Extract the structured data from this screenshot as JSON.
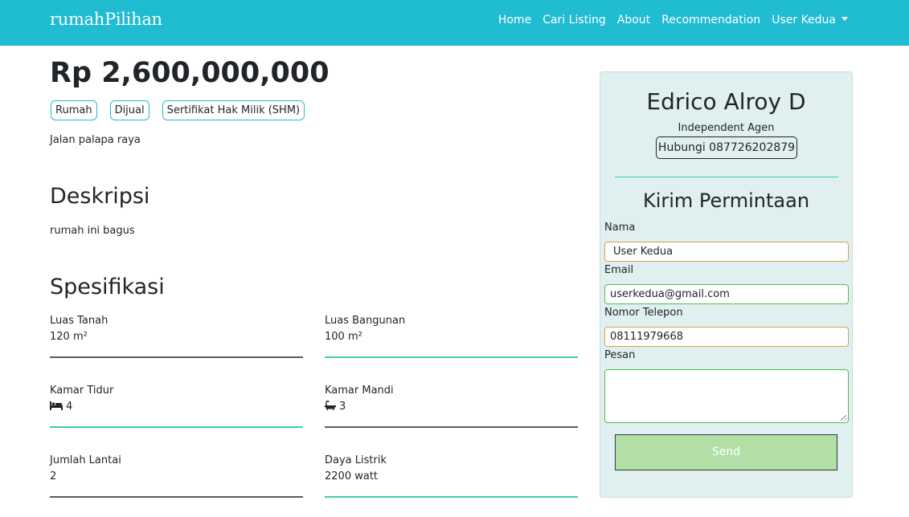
{
  "navbar": {
    "brand": "rumahPilihan",
    "links": [
      "Home",
      "Cari Listing",
      "About",
      "Recommendation"
    ],
    "user_menu": "User Kedua",
    "caret_icon": "chevron-down-icon"
  },
  "listing": {
    "price": "Rp 2,600,000,000",
    "badges": [
      "Rumah",
      "Dijual",
      "Sertifikat Hak Milik (SHM)"
    ],
    "address": "Jalan palapa raya"
  },
  "description": {
    "heading": "Deskripsi",
    "text": "rumah ini bagus"
  },
  "specs": {
    "heading": "Spesifikasi",
    "items": [
      {
        "label": "Luas Tanah",
        "value": "120 m²"
      },
      {
        "label": "Luas Bangunan",
        "value": "100 m²"
      },
      {
        "label": "Kamar Tidur",
        "value": "4",
        "icon": "bed-icon"
      },
      {
        "label": "Kamar Mandi",
        "value": "3",
        "icon": "bathtub-icon"
      },
      {
        "label": "Jumlah Lantai",
        "value": "2"
      },
      {
        "label": "Daya Listrik",
        "value": "2200 watt"
      }
    ]
  },
  "agent": {
    "name": "Edrico Alroy D",
    "role": "Independent Agen",
    "contact_button": "Hubungi 087726202879"
  },
  "inquiry_form": {
    "title": "Kirim Permintaan",
    "name_label": "Nama",
    "name_value": "User Kedua",
    "email_label": "Email",
    "email_value": "userkedua@gmail.com",
    "phone_label": "Nomor Telepon",
    "phone_value": "08111979668",
    "message_label": "Pesan",
    "message_value": "",
    "send_button": "Send"
  },
  "colors": {
    "navbar": "#20bcd2",
    "accent_teal": "#3ccfb4",
    "card_background": "#e0efef",
    "send_button": "#b2dfa5"
  }
}
